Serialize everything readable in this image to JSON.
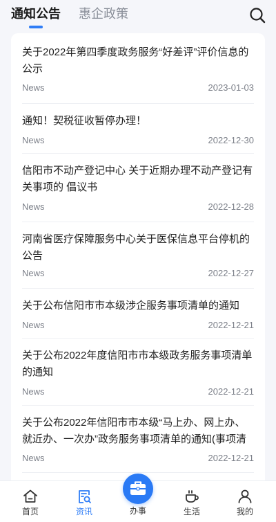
{
  "header": {
    "tabs": [
      {
        "label": "通知公告",
        "active": true
      },
      {
        "label": "惠企政策",
        "active": false
      }
    ],
    "search_icon": "search-icon"
  },
  "colors": {
    "accent": "#2f7df6",
    "background": "#f5f6fa",
    "card": "#ffffff",
    "text": "#222222",
    "muted": "#7d818a"
  },
  "news": [
    {
      "title": "关于2022年第四季度政务服务“好差评”评价信息的公示",
      "source": "News",
      "date": "2023-01-03"
    },
    {
      "title": "通知！契税征收暂停办理！",
      "source": "News",
      "date": "2022-12-30"
    },
    {
      "title": "信阳市不动产登记中心 关于近期办理不动产登记有关事项的 倡议书",
      "source": "News",
      "date": "2022-12-28"
    },
    {
      "title": "河南省医疗保障服务中心关于医保信息平台停机的公告",
      "source": "News",
      "date": "2022-12-27"
    },
    {
      "title": "关于公布信阳市市本级涉企服务事项清单的通知",
      "source": "News",
      "date": "2022-12-21"
    },
    {
      "title": "关于公布2022年度信阳市市本级政务服务事项清单的通知",
      "source": "News",
      "date": "2022-12-21"
    },
    {
      "title": "关于公布2022年信阳市市本级“马上办、网上办、就近办、一次办”政务服务事项清单的通知(事项清",
      "source": "News",
      "date": "2022-12-21"
    }
  ],
  "nav": {
    "items": [
      {
        "label": "首页",
        "icon": "home-icon",
        "active": false
      },
      {
        "label": "资讯",
        "icon": "news-icon",
        "active": true
      },
      {
        "label": "办事",
        "icon": "briefcase-icon",
        "active": false
      },
      {
        "label": "生活",
        "icon": "coffee-icon",
        "active": false
      },
      {
        "label": "我的",
        "icon": "user-icon",
        "active": false
      }
    ]
  }
}
